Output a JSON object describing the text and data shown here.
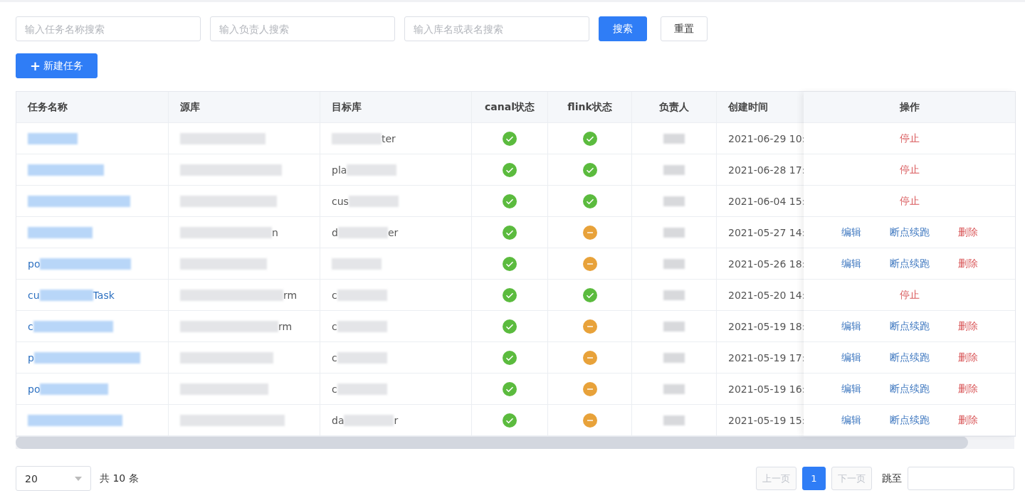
{
  "filters": [
    {
      "placeholder": "输入任务名称搜索"
    },
    {
      "placeholder": "输入负责人搜索"
    },
    {
      "placeholder": "输入库名或表名搜索"
    }
  ],
  "search_button": "搜索",
  "reset_button": "重置",
  "new_button": {
    "icon": "+",
    "label": "新建任务"
  },
  "table": {
    "columns": [
      "任务名称",
      "源库",
      "目标库",
      "canal状态",
      "flink状态",
      "负责人",
      "创建时间",
      "操作"
    ],
    "rows": [
      {
        "name": {},
        "source": {},
        "target": {
          "end": "ter"
        },
        "canal_ok": true,
        "flink_ok": true,
        "created": "2021-06-29 10:",
        "actions": [
          {
            "label": "停止",
            "kind": "danger"
          }
        ]
      },
      {
        "name": {},
        "source": {},
        "target": {
          "start": "pla"
        },
        "canal_ok": true,
        "flink_ok": true,
        "created": "2021-06-28 17:",
        "actions": [
          {
            "label": "停止",
            "kind": "danger"
          }
        ]
      },
      {
        "name": {},
        "source": {},
        "target": {
          "start": "cus"
        },
        "canal_ok": true,
        "flink_ok": true,
        "created": "2021-06-04 15:",
        "actions": [
          {
            "label": "停止",
            "kind": "danger"
          }
        ]
      },
      {
        "name": {},
        "source": {
          "end": "n"
        },
        "target": {
          "start": "d",
          "end": "er"
        },
        "canal_ok": true,
        "flink_ok": false,
        "created": "2021-05-27 14:",
        "actions": [
          {
            "label": "编辑",
            "kind": "link"
          },
          {
            "label": "断点续跑",
            "kind": "link"
          },
          {
            "label": "删除",
            "kind": "danger"
          }
        ]
      },
      {
        "name": {
          "start": "po"
        },
        "source": {},
        "target": {},
        "canal_ok": true,
        "flink_ok": false,
        "created": "2021-05-26 18:",
        "actions": [
          {
            "label": "编辑",
            "kind": "link"
          },
          {
            "label": "断点续跑",
            "kind": "link"
          },
          {
            "label": "删除",
            "kind": "danger"
          }
        ]
      },
      {
        "name": {
          "start": "cu",
          "end": "Task"
        },
        "source": {
          "end": "rm"
        },
        "target": {
          "start": "c"
        },
        "canal_ok": true,
        "flink_ok": true,
        "created": "2021-05-20 14:",
        "actions": [
          {
            "label": "停止",
            "kind": "danger"
          }
        ]
      },
      {
        "name": {
          "start": "c"
        },
        "source": {
          "end": "rm"
        },
        "target": {
          "start": "c"
        },
        "canal_ok": true,
        "flink_ok": false,
        "created": "2021-05-19 18:",
        "actions": [
          {
            "label": "编辑",
            "kind": "link"
          },
          {
            "label": "断点续跑",
            "kind": "link"
          },
          {
            "label": "删除",
            "kind": "danger"
          }
        ]
      },
      {
        "name": {
          "start": "p"
        },
        "source": {},
        "target": {
          "start": "c"
        },
        "canal_ok": true,
        "flink_ok": false,
        "created": "2021-05-19 17:",
        "actions": [
          {
            "label": "编辑",
            "kind": "link"
          },
          {
            "label": "断点续跑",
            "kind": "link"
          },
          {
            "label": "删除",
            "kind": "danger"
          }
        ]
      },
      {
        "name": {
          "start": "po"
        },
        "source": {},
        "target": {
          "start": "c"
        },
        "canal_ok": true,
        "flink_ok": false,
        "created": "2021-05-19 16:",
        "actions": [
          {
            "label": "编辑",
            "kind": "link"
          },
          {
            "label": "断点续跑",
            "kind": "link"
          },
          {
            "label": "删除",
            "kind": "danger"
          }
        ]
      },
      {
        "name": {},
        "source": {},
        "target": {
          "start": "da",
          "end": "r"
        },
        "canal_ok": true,
        "flink_ok": false,
        "created": "2021-05-19 15:",
        "actions": [
          {
            "label": "编辑",
            "kind": "link"
          },
          {
            "label": "断点续跑",
            "kind": "link"
          },
          {
            "label": "删除",
            "kind": "danger"
          }
        ]
      }
    ]
  },
  "pagination": {
    "page_size": "20",
    "total": "共 10 条",
    "prev": "上一页",
    "pages": [
      {
        "label": "1",
        "selected": true
      }
    ],
    "next": "下一页",
    "jump_label": "跳至"
  }
}
